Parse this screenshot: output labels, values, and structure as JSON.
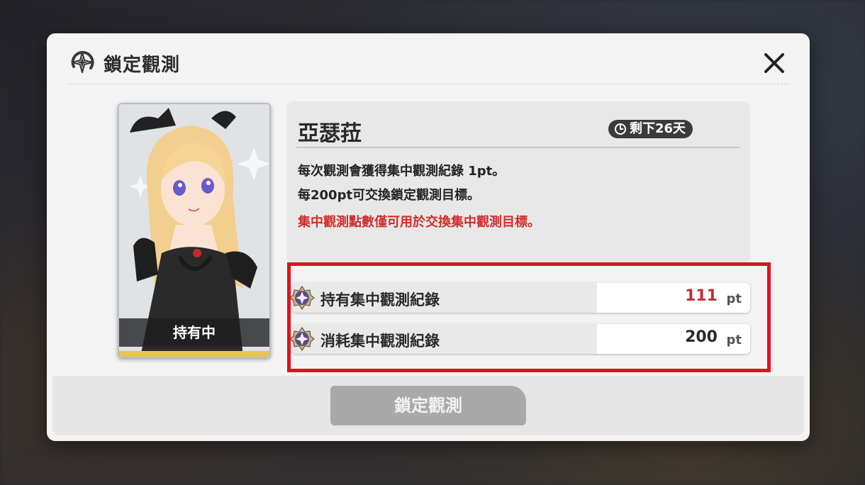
{
  "dialog": {
    "title": "鎖定觀測",
    "title_icon": "compass-star-icon",
    "close_icon": "close-icon"
  },
  "card": {
    "status_label": "持有中",
    "accent_color": "#e6c64a"
  },
  "info": {
    "character_name": "亞瑟菈",
    "days_left": "剩下26天",
    "desc_line1": "每次觀測會獲得集中觀測紀錄 1pt。",
    "desc_line2": "每200pt可交換鎖定觀測目標。",
    "warning": "集中觀測點數僅可用於交換集中觀測目標。",
    "warning_color": "#d32b2b"
  },
  "points": [
    {
      "label": "持有集中觀測紀錄",
      "value": "111",
      "unit": "pt",
      "icon": "star-medal-icon"
    },
    {
      "label": "消耗集中觀測紀錄",
      "value": "200",
      "unit": "pt",
      "icon": "star-medal-icon"
    }
  ],
  "footer": {
    "confirm_label": "鎖定觀測"
  },
  "colors": {
    "highlight": "#e1101f",
    "button_disabled": "#a9a9a9"
  }
}
